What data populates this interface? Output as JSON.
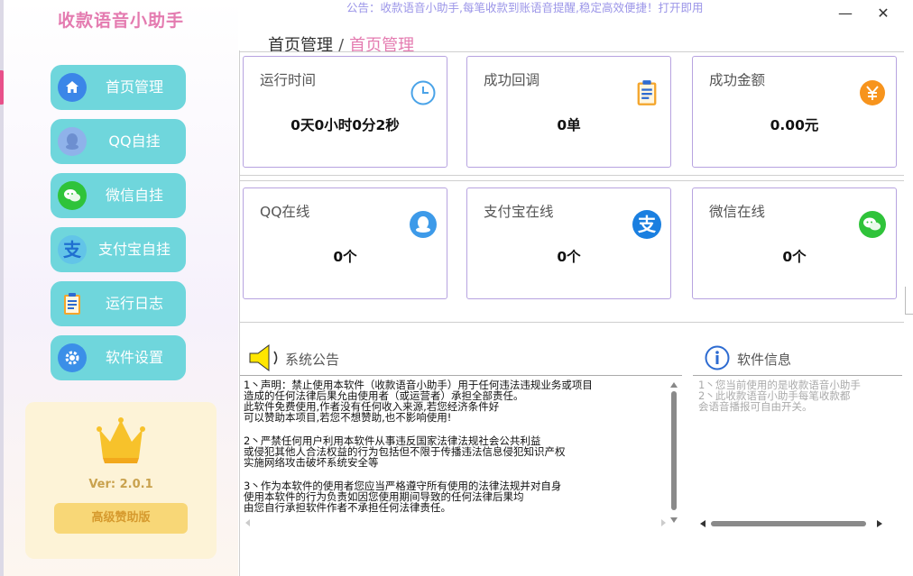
{
  "app": {
    "title": "收款语音小助手"
  },
  "notice": {
    "text": "公告：收款语音小助手,每笔收款到账语音提醒,稳定高效便捷！打开即用"
  },
  "window": {
    "minimize": "—",
    "close": "✕"
  },
  "breadcrumb": {
    "root": "首页管理",
    "separator": "/",
    "current": "首页管理"
  },
  "sidebar": {
    "items": [
      {
        "label": "首页管理",
        "icon": "home-icon"
      },
      {
        "label": "QQ自挂",
        "icon": "qq-icon"
      },
      {
        "label": "微信自挂",
        "icon": "wechat-icon"
      },
      {
        "label": "支付宝自挂",
        "icon": "alipay-icon"
      },
      {
        "label": "运行日志",
        "icon": "clipboard-icon"
      },
      {
        "label": "软件设置",
        "icon": "gear-icon"
      }
    ]
  },
  "vip": {
    "version": "Ver:  2.0.1",
    "button": "高级赞助版",
    "icon": "crown-icon"
  },
  "stats": [
    {
      "title": "运行时间",
      "value": "0天0小时0分2秒",
      "icon": "clock-icon"
    },
    {
      "title": "成功回调",
      "value": "0单",
      "icon": "clipboard-icon"
    },
    {
      "title": "成功金额",
      "value": "0.00元",
      "icon": "yen-icon"
    },
    {
      "title": "QQ在线",
      "value": "0个",
      "icon": "qq-icon"
    },
    {
      "title": "支付宝在线",
      "value": "0个",
      "icon": "alipay-icon"
    },
    {
      "title": "微信在线",
      "value": "0个",
      "icon": "wechat-icon"
    }
  ],
  "announcement": {
    "label": "系统公告",
    "icon": "speaker-icon",
    "lines": [
      "1丶声明：禁止使用本软件（收款语音小助手）用于任何违法违规业务或项目",
      "造成的任何法律后果允由使用者（或运营者）承担全部责任。",
      "此软件免费使用,作者没有任何收入来源,若您经济条件好",
      "可以赞助本项目,若您不想赞助,也不影响使用!",
      "",
      "2丶严禁任何用户利用本软件从事违反国家法律法规社会公共利益",
      "或侵犯其他人合法权益的行为包括但不限于传播违法信息侵犯知识产权",
      "实施网络攻击破坏系统安全等",
      "",
      "3丶作为本软件的使用者您应当严格遵守所有使用的法律法规并对自身",
      "使用本软件的行为负责如因您使用期间导致的任何法律后果均",
      "由您自行承担软件作者不承担任何法律责任。"
    ]
  },
  "software_info": {
    "label": "软件信息",
    "icon": "info-icon",
    "lines": [
      "1丶您当前使用的是收款语音小助手",
      "",
      "2丶此收款语音小助手每笔收款都",
      "会语音播报可自由开关。"
    ]
  },
  "colors": {
    "accent_pink": "#e47bb0",
    "nav_bg": "#6fd6dc",
    "card_border": "#b7a3e0",
    "notice": "#9b95e8"
  }
}
